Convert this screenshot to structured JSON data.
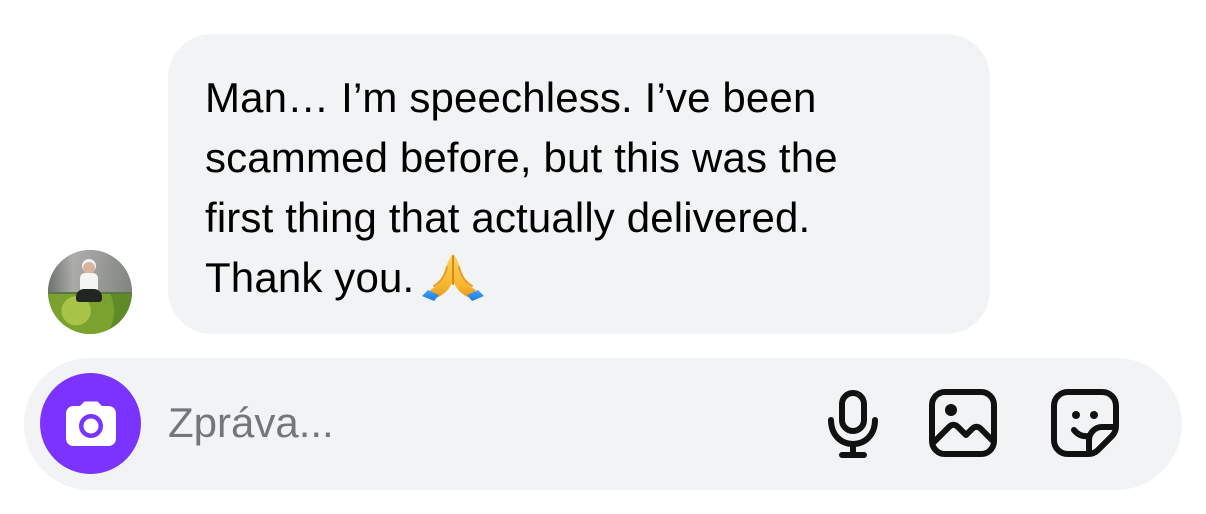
{
  "conversation": {
    "received_message": {
      "lines": [
        "Man… I’m speechless. I’ve been",
        "scammed before, but this was the",
        "first thing that actually delivered.",
        "Thank you."
      ],
      "emoji": "🙏",
      "emoji_name": "folded-hands-icon",
      "sender_avatar_name": "avatar"
    }
  },
  "composer": {
    "camera_icon": "camera-icon",
    "placeholder": "Zpráva...",
    "microphone_icon": "microphone-icon",
    "photo_icon": "image-icon",
    "sticker_icon": "sticker-icon",
    "accent_color": "#7b34ff",
    "background_color": "#f2f3f5"
  },
  "colors": {
    "bubble_background": "#f2f3f5",
    "text": "#000000",
    "placeholder": "#73777d",
    "icon": "#111111"
  }
}
